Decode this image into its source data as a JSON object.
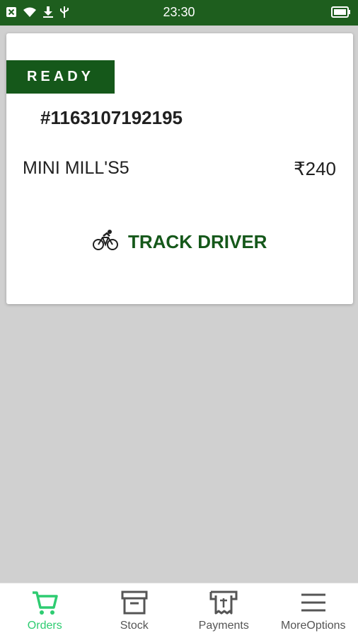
{
  "status_bar": {
    "time": "23:30",
    "icons": [
      "notification-icon",
      "wifi-icon",
      "download-icon",
      "usb-icon",
      "battery-icon"
    ]
  },
  "order": {
    "status": "READY",
    "order_id": "#1163107192195",
    "item_name": "MINI MILL'S5",
    "price": "₹240",
    "track_label": "TRACK DRIVER"
  },
  "nav": {
    "items": [
      {
        "label": "Orders",
        "icon": "cart-icon",
        "active": true
      },
      {
        "label": "Stock",
        "icon": "archive-box-icon",
        "active": false
      },
      {
        "label": "Payments",
        "icon": "receipt-icon",
        "active": false
      },
      {
        "label": "MoreOptions",
        "icon": "menu-icon",
        "active": false
      }
    ]
  },
  "colors": {
    "brand_green": "#1e5e1e",
    "badge_green": "#15581a",
    "active_green": "#2ecc71",
    "background": "#d0d0d0"
  }
}
